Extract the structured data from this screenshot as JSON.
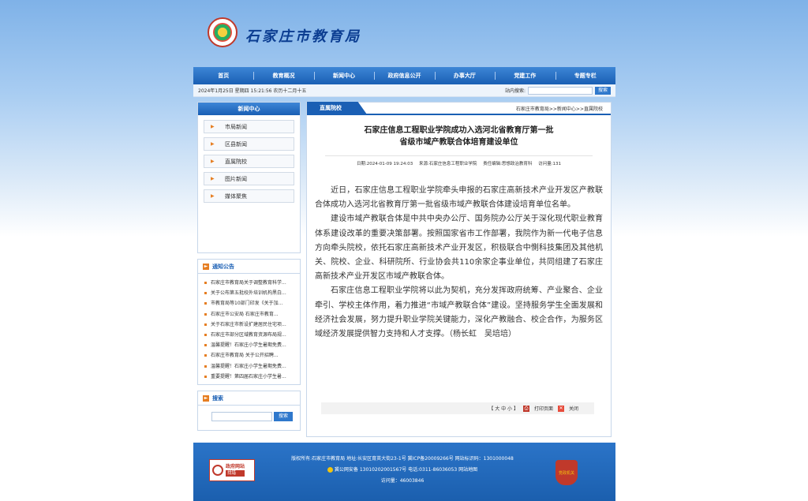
{
  "header": {
    "site_title": "石家庄市教育局"
  },
  "nav": [
    "首页",
    "教育概况",
    "新闻中心",
    "政府信息公开",
    "办事大厅",
    "党建工作",
    "专题专栏"
  ],
  "infobar": {
    "datetime": "2024年1月25日 星期四 15:21:56 农历十二月十五",
    "search_label": "站内搜索:",
    "search_button": "搜索"
  },
  "sidebar": {
    "news_center_title": "新闻中心",
    "categories": [
      "市局新闻",
      "区县新闻",
      "直属院校",
      "图片新闻",
      "媒体聚焦"
    ],
    "notice_title": "通知公告",
    "notices": [
      "石家庄市教育局关于调整教育科学...",
      "关于公布第五批校外培训机构黑白...",
      "市教育局等10部门印发《关于加...",
      "石家庄市公安局 石家庄市教育...",
      "关于石家庄市新设扩建居民住宅项...",
      "石家庄市部分区域教育资源布局规...",
      "温馨提醒！石家庄小学生暑期免费...",
      "石家庄市教育局 关于公开招聘...",
      "温馨提醒！石家庄小学生暑期免费...",
      "重要提醒！第四届石家庄小学生暑..."
    ],
    "search_title": "搜索",
    "search_button": "搜索"
  },
  "main": {
    "tab": "直属院校",
    "breadcrumb": "石家庄市教育局>>新闻中心>>直属院校",
    "title_line1": "石家庄信息工程职业学院成功入选河北省教育厅第一批",
    "title_line2": "省级市域产教联合体培育建设单位",
    "meta": {
      "date": "日期:2024-01-09 19:24:03",
      "source": "来源:石家庄信息工程职业学院",
      "editor": "责任编辑:思想政治教育科",
      "views": "访问量:131"
    },
    "paragraphs": [
      "近日，石家庄信息工程职业学院牵头申报的石家庄高新技术产业开发区产教联合体成功入选河北省教育厅第一批省级市域产教联合体建设培育单位名单。",
      "建设市域产教联合体是中共中央办公厅、国务院办公厅关于深化现代职业教育体系建设改革的重要决策部署。按照国家省市工作部署，我院作为新一代电子信息方向牵头院校，依托石家庄高新技术产业开发区，积极联合中惻科技集团及其他机关、院校、企业、科研院所、行业协会共110余家企事业单位，共同组建了石家庄高新技术产业开发区市域产教联合体。",
      "石家庄信息工程职业学院将以此为契机，充分发挥政府统筹、产业聚合、企业牵引、学校主体作用，着力推进“市域产教联合体”建设。坚持服务学生全面发展和经济社会发展，努力提升职业学院关键能力，深化产教融合、校企合作，为服务区域经济发展提供智力支持和人才支撑。（杨长虹　吴培培）"
    ],
    "toolbar": {
      "font_size": "【 大 中 小 】",
      "print": "打印页面",
      "close": "关闭"
    }
  },
  "footer": {
    "line1": "版权所有:石家庄市教育局  地址:长安区育英大街23-1号  冀ICP备20009266号  网站标识码：1301000048",
    "line2": "冀公网安备 13010202001567号  电话:0311-86036053  网站地图",
    "line3": "访问量：46003846",
    "gov_badge_top": "政府网站",
    "gov_badge_bottom": "找错",
    "party_badge": "党政机关"
  },
  "colors": {
    "primary": "#1a5fb4",
    "accent": "#e67e22"
  }
}
